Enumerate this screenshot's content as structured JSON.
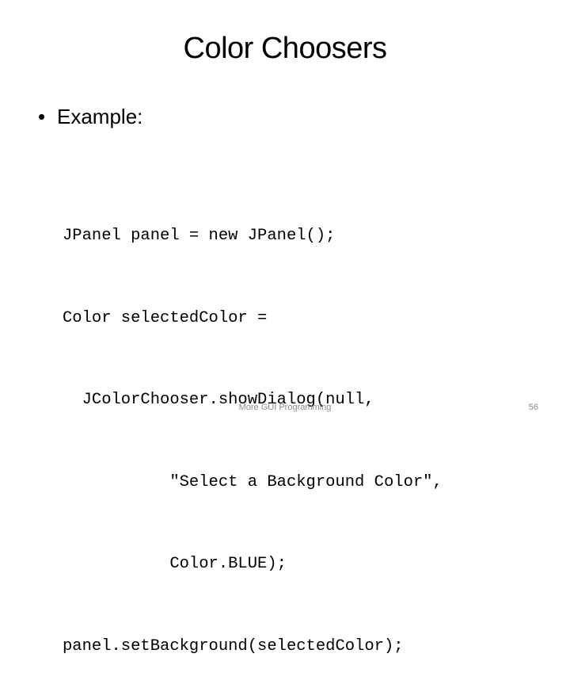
{
  "slide": {
    "title": "Color Choosers",
    "bullet": {
      "symbol": "•",
      "text": "Example:"
    },
    "code_lines": [
      "JPanel panel = new JPanel();",
      "Color selectedColor =",
      "  JColorChooser.showDialog(null,",
      "           \"Select a Background Color\",",
      "           Color.BLUE);",
      "panel.setBackground(selectedColor);"
    ],
    "footer": {
      "text": "More GUI Programming",
      "page_number": "56"
    }
  }
}
